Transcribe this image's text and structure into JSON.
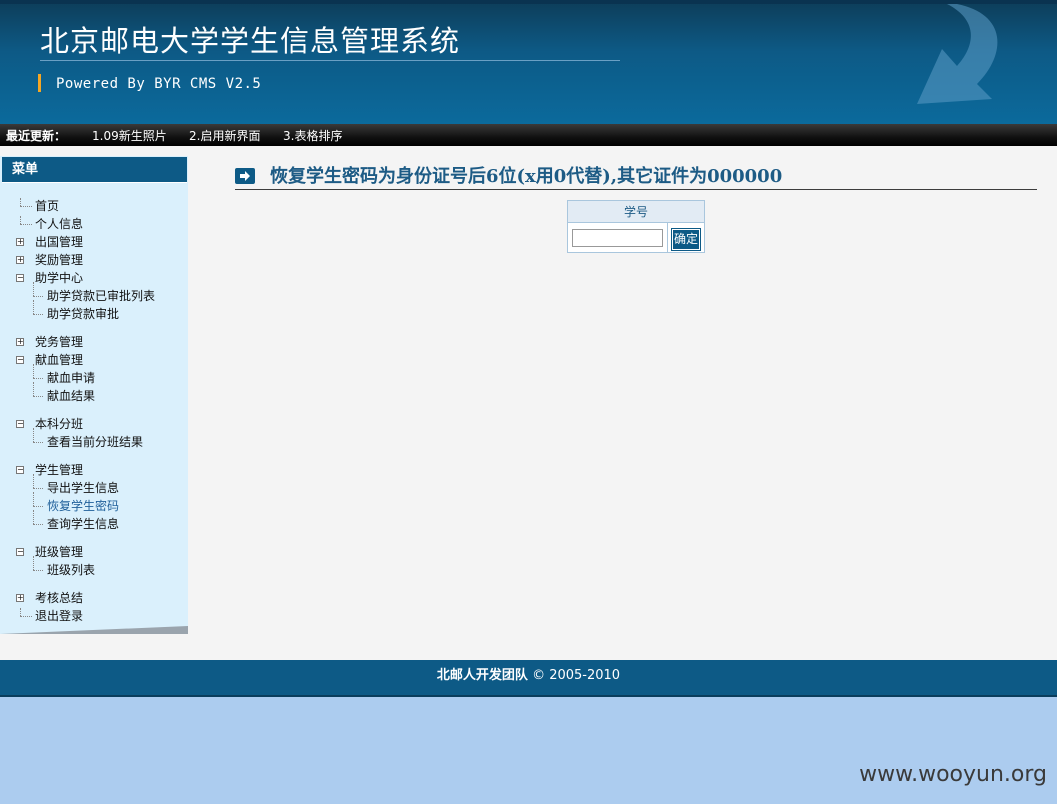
{
  "header": {
    "title": "北京邮电大学学生信息管理系统",
    "powered": "Powered By BYR CMS V2.5"
  },
  "newsbar": {
    "label": "最近更新：",
    "items": [
      "1.09新生照片",
      "2.启用新界面",
      "3.表格排序"
    ]
  },
  "sidebar": {
    "title": "菜单",
    "items": [
      {
        "label": "首页",
        "state": "leaf"
      },
      {
        "label": "个人信息",
        "state": "leaf"
      },
      {
        "label": "出国管理",
        "state": "collapsed"
      },
      {
        "label": "奖励管理",
        "state": "collapsed"
      },
      {
        "label": "助学中心",
        "state": "expanded"
      },
      {
        "label": "助学贷款已审批列表",
        "state": "child"
      },
      {
        "label": "助学贷款审批",
        "state": "child"
      },
      {
        "label": "党务管理",
        "state": "collapsed"
      },
      {
        "label": "献血管理",
        "state": "expanded"
      },
      {
        "label": "献血申请",
        "state": "child"
      },
      {
        "label": "献血结果",
        "state": "child"
      },
      {
        "label": "本科分班",
        "state": "expanded"
      },
      {
        "label": "查看当前分班结果",
        "state": "child"
      },
      {
        "label": "学生管理",
        "state": "expanded"
      },
      {
        "label": "导出学生信息",
        "state": "child"
      },
      {
        "label": "恢复学生密码",
        "state": "child-active"
      },
      {
        "label": "查询学生信息",
        "state": "child"
      },
      {
        "label": "班级管理",
        "state": "expanded"
      },
      {
        "label": "班级列表",
        "state": "child"
      },
      {
        "label": "考核总结",
        "state": "collapsed"
      },
      {
        "label": "退出登录",
        "state": "leaf"
      }
    ]
  },
  "content": {
    "title": "恢复学生密码为身份证号后6位(x用0代替),其它证件为000000",
    "form": {
      "field_label": "学号",
      "input_value": "",
      "submit_label": "确定"
    }
  },
  "footer": {
    "team": "北邮人开发团队",
    "copyright": "© 2005-2010"
  },
  "watermark": "www.wooyun.org",
  "colors": {
    "header_bg": "#0d5a86",
    "sidebar_bg": "#daf0fc",
    "title_color": "#1d5b85",
    "page_bg": "#acccef"
  }
}
